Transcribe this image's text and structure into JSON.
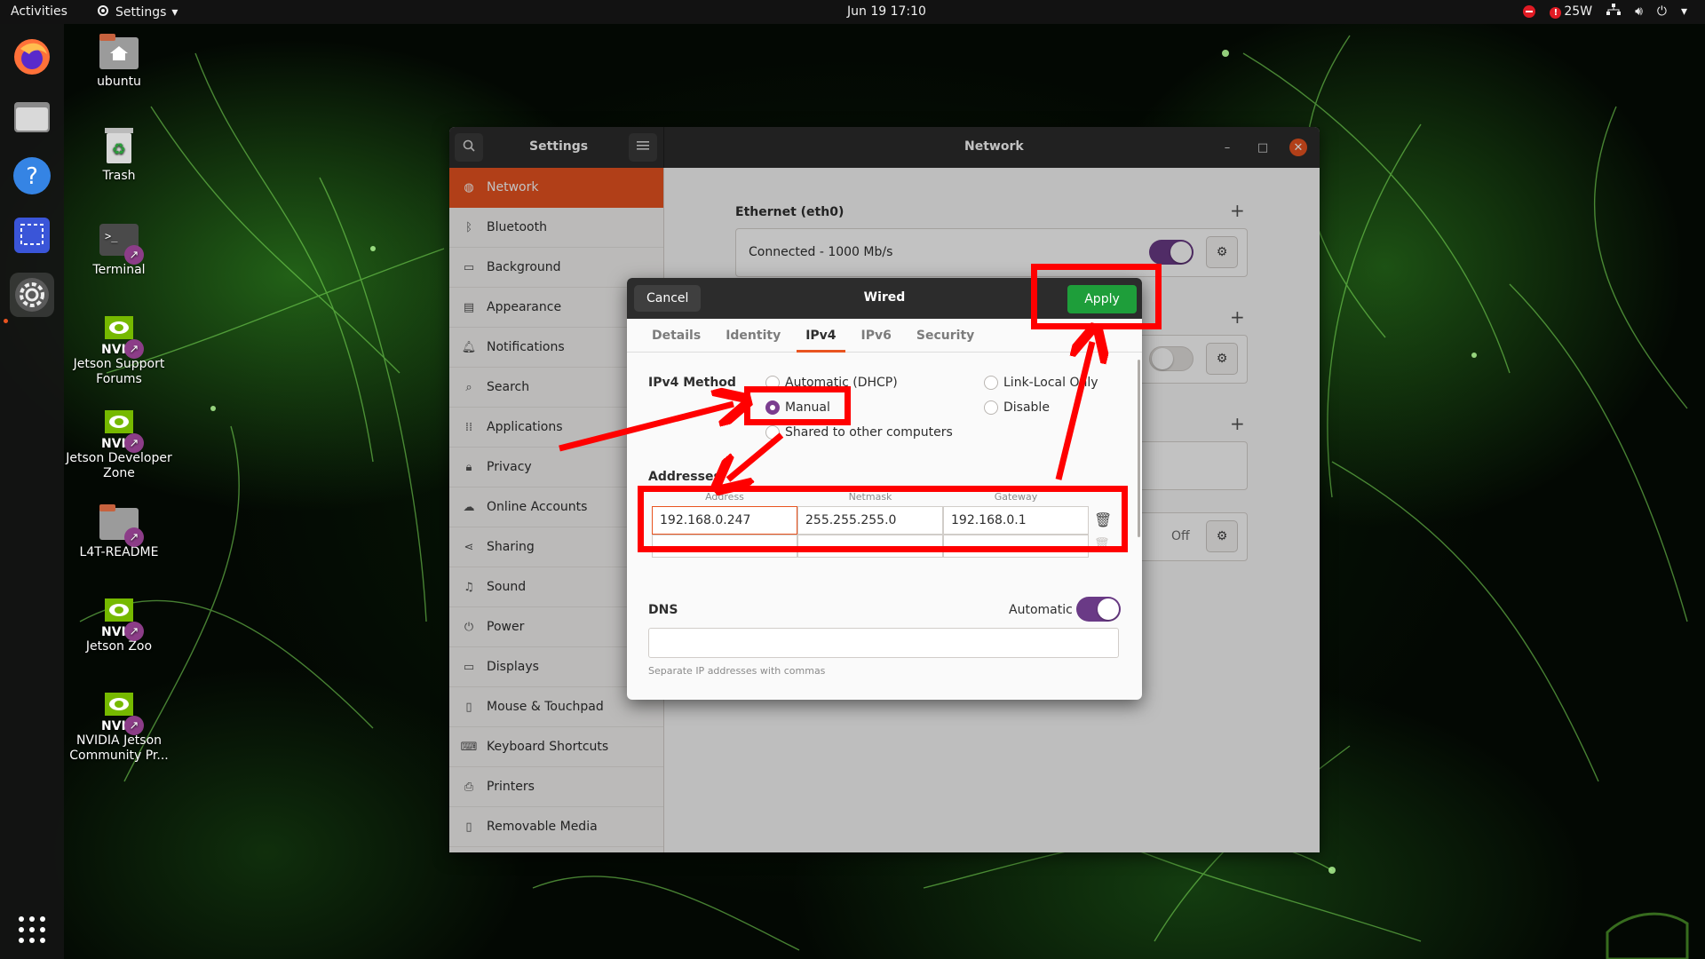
{
  "topbar": {
    "activities": "Activities",
    "app_menu": "Settings",
    "clock": "Jun 19  17:10",
    "power": "25W"
  },
  "dock": {
    "apps": [
      "firefox-icon",
      "files-icon",
      "help-icon",
      "screenshot-icon",
      "settings-icon"
    ],
    "show_apps": "grid-icon"
  },
  "desktop": {
    "icons": [
      {
        "label": "ubuntu"
      },
      {
        "label": "Trash"
      },
      {
        "label": "Terminal"
      },
      {
        "label": "Jetson Support Forums"
      },
      {
        "label": "Jetson Developer Zone"
      },
      {
        "label": "L4T-README"
      },
      {
        "label": "Jetson Zoo"
      },
      {
        "label": "NVIDIA Jetson Community Pr..."
      }
    ],
    "nvidia_mark": "NVIDIA"
  },
  "settings": {
    "sidebar_title": "Settings",
    "page_title": "Network",
    "sidebar_items": [
      {
        "label": "Network",
        "icon": "network-icon"
      },
      {
        "label": "Bluetooth",
        "icon": "bluetooth-icon"
      },
      {
        "label": "Background",
        "icon": "background-icon"
      },
      {
        "label": "Appearance",
        "icon": "appearance-icon"
      },
      {
        "label": "Notifications",
        "icon": "bell-icon"
      },
      {
        "label": "Search",
        "icon": "search-icon"
      },
      {
        "label": "Applications",
        "icon": "applications-icon"
      },
      {
        "label": "Privacy",
        "icon": "lock-icon"
      },
      {
        "label": "Online Accounts",
        "icon": "cloud-icon"
      },
      {
        "label": "Sharing",
        "icon": "share-icon"
      },
      {
        "label": "Sound",
        "icon": "music-note-icon"
      },
      {
        "label": "Power",
        "icon": "power-icon"
      },
      {
        "label": "Displays",
        "icon": "display-icon"
      },
      {
        "label": "Mouse & Touchpad",
        "icon": "mouse-icon"
      },
      {
        "label": "Keyboard Shortcuts",
        "icon": "keyboard-icon"
      },
      {
        "label": "Printers",
        "icon": "printer-icon"
      },
      {
        "label": "Removable Media",
        "icon": "media-icon"
      }
    ],
    "ethernet_title": "Ethernet (eth0)",
    "ethernet_status": "Connected - 1000 Mb/s",
    "proxy_state": "Off"
  },
  "dialog": {
    "title": "Wired",
    "cancel": "Cancel",
    "apply": "Apply",
    "tabs": [
      "Details",
      "Identity",
      "IPv4",
      "IPv6",
      "Security"
    ],
    "selected_tab": "IPv4",
    "ipv4_method_label": "IPv4 Method",
    "methods": {
      "auto": "Automatic (DHCP)",
      "link_local": "Link-Local Only",
      "manual": "Manual",
      "disable": "Disable",
      "shared": "Shared to other computers"
    },
    "selected_method": "Manual",
    "addresses_label": "Addresses",
    "columns": [
      "Address",
      "Netmask",
      "Gateway"
    ],
    "row": {
      "address": "192.168.0.247",
      "netmask": "255.255.255.0",
      "gateway": "192.168.0.1"
    },
    "dns_label": "DNS",
    "dns_automatic": "Automatic",
    "dns_value": "",
    "dns_hint": "Separate IP addresses with commas"
  },
  "colors": {
    "accent": "#e95420",
    "toggle": "#6a3a86",
    "apply": "#1e9e3a",
    "annotation": "#ff0000"
  }
}
